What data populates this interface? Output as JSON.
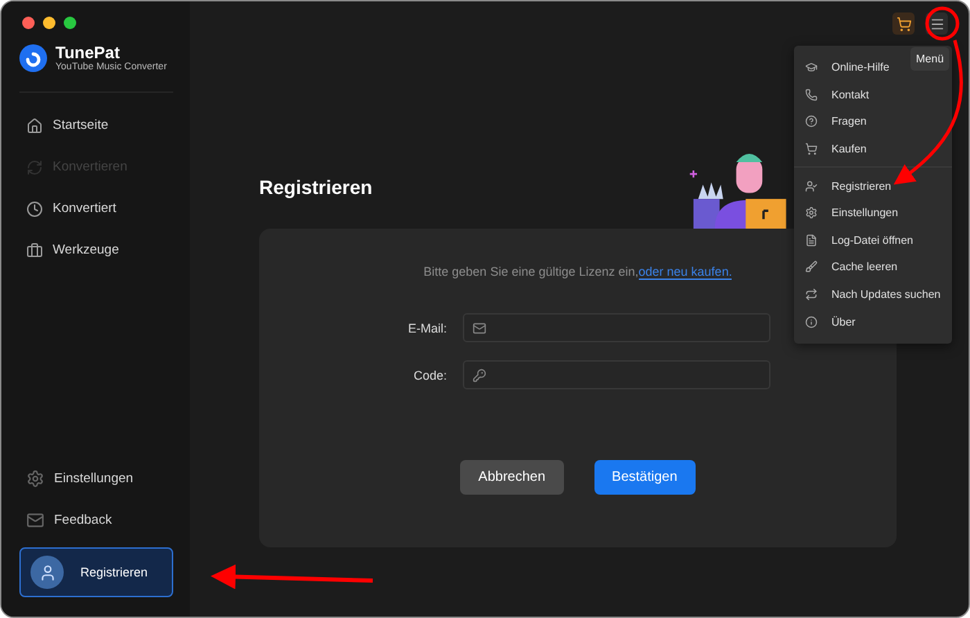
{
  "app": {
    "name": "TunePat",
    "subtitle": "YouTube Music Converter"
  },
  "nav": [
    {
      "label": "Startseite",
      "disabled": false
    },
    {
      "label": "Konvertieren",
      "disabled": true
    },
    {
      "label": "Konvertiert",
      "disabled": false
    },
    {
      "label": "Werkzeuge",
      "disabled": false
    }
  ],
  "bottom_nav": [
    {
      "label": "Einstellungen"
    },
    {
      "label": "Feedback"
    }
  ],
  "register_button": {
    "label": "Registrieren"
  },
  "page_title": "Registrieren",
  "form": {
    "prompt": "Bitte geben Sie eine gültige Lizenz ein,",
    "prompt_link": "oder neu kaufen.",
    "fields": [
      {
        "label": "E-Mail:",
        "kind": "email"
      },
      {
        "label": "Code:",
        "kind": "key"
      }
    ],
    "cancel": "Abbrechen",
    "confirm": "Bestätigen"
  },
  "menu_tooltip": "Menü",
  "menu": {
    "groups": [
      [
        {
          "label": "Online-Hilfe"
        },
        {
          "label": "Kontakt"
        },
        {
          "label": "Fragen"
        },
        {
          "label": "Kaufen"
        }
      ],
      [
        {
          "label": "Registrieren"
        },
        {
          "label": "Einstellungen"
        },
        {
          "label": "Log-Datei öffnen"
        },
        {
          "label": "Cache leeren"
        },
        {
          "label": "Nach Updates suchen"
        },
        {
          "label": "Über"
        }
      ]
    ]
  }
}
